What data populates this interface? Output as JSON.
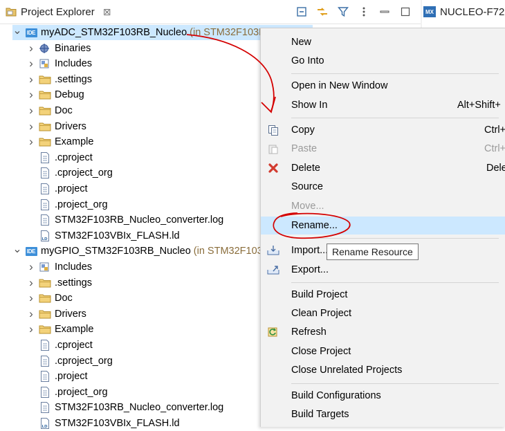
{
  "view": {
    "title": "Project Explorer",
    "close_glyph": "⊠",
    "toolbar": [
      "collapse-all-icon",
      "link-with-editor-icon",
      "filter-icon",
      "view-menu-icon",
      "minimize-icon",
      "maximize-icon"
    ]
  },
  "editor_tab": {
    "badge": "MX",
    "title": "NUCLEO-F72"
  },
  "tree": [
    {
      "label": "myADC_STM32F103RB_Nucleo",
      "decor": "(in STM32F103RB_Nucleo)",
      "icon": "ide",
      "indent": 0,
      "expandable": true,
      "expanded": true,
      "selected": true
    },
    {
      "label": "Binaries",
      "icon": "binaries",
      "indent": 1,
      "expandable": true
    },
    {
      "label": "Includes",
      "icon": "includes",
      "indent": 1,
      "expandable": true
    },
    {
      "label": ".settings",
      "icon": "folder",
      "indent": 1,
      "expandable": true
    },
    {
      "label": "Debug",
      "icon": "folder",
      "indent": 1,
      "expandable": true
    },
    {
      "label": "Doc",
      "icon": "folder",
      "indent": 1,
      "expandable": true
    },
    {
      "label": "Drivers",
      "icon": "folder",
      "indent": 1,
      "expandable": true
    },
    {
      "label": "Example",
      "icon": "folder",
      "indent": 1,
      "expandable": true
    },
    {
      "label": ".cproject",
      "icon": "file",
      "indent": 1
    },
    {
      "label": ".cproject_org",
      "icon": "file",
      "indent": 1
    },
    {
      "label": ".project",
      "icon": "file",
      "indent": 1
    },
    {
      "label": ".project_org",
      "icon": "file",
      "indent": 1
    },
    {
      "label": "STM32F103RB_Nucleo_converter.log",
      "icon": "file",
      "indent": 1
    },
    {
      "label": "STM32F103VBIx_FLASH.ld",
      "icon": "ld",
      "indent": 1
    },
    {
      "label": "myGPIO_STM32F103RB_Nucleo",
      "decor": "(in STM32F103R",
      "icon": "ide",
      "indent": 0,
      "expandable": true,
      "expanded": true
    },
    {
      "label": "Includes",
      "icon": "includes",
      "indent": 1,
      "expandable": true
    },
    {
      "label": ".settings",
      "icon": "folder",
      "indent": 1,
      "expandable": true
    },
    {
      "label": "Doc",
      "icon": "folder",
      "indent": 1,
      "expandable": true
    },
    {
      "label": "Drivers",
      "icon": "folder",
      "indent": 1,
      "expandable": true
    },
    {
      "label": "Example",
      "icon": "folder",
      "indent": 1,
      "expandable": true
    },
    {
      "label": ".cproject",
      "icon": "file",
      "indent": 1
    },
    {
      "label": ".cproject_org",
      "icon": "file",
      "indent": 1
    },
    {
      "label": ".project",
      "icon": "file",
      "indent": 1
    },
    {
      "label": ".project_org",
      "icon": "file",
      "indent": 1
    },
    {
      "label": "STM32F103RB_Nucleo_converter.log",
      "icon": "file",
      "indent": 1
    },
    {
      "label": "STM32F103VBIx_FLASH.ld",
      "icon": "ld",
      "indent": 1
    }
  ],
  "menu": [
    {
      "label": "New"
    },
    {
      "label": "Go Into"
    },
    {
      "sep": true
    },
    {
      "label": "Open in New Window"
    },
    {
      "label": "Show In",
      "shortcut": "Alt+Shift+"
    },
    {
      "sep": true
    },
    {
      "label": "Copy",
      "shortcut": "Ctrl+",
      "icon": "copy-icon"
    },
    {
      "label": "Paste",
      "shortcut": "Ctrl+",
      "icon": "paste-icon",
      "disabled": true
    },
    {
      "label": "Delete",
      "shortcut": "Dele",
      "icon": "delete-icon"
    },
    {
      "label": "Source"
    },
    {
      "label": "Move...",
      "disabled": true
    },
    {
      "label": "Rename...",
      "highlighted": true
    },
    {
      "sep": true
    },
    {
      "label": "Import...",
      "icon": "import-icon"
    },
    {
      "label": "Export...",
      "icon": "export-icon"
    },
    {
      "sep": true
    },
    {
      "label": "Build Project"
    },
    {
      "label": "Clean Project"
    },
    {
      "label": "Refresh",
      "icon": "refresh-icon"
    },
    {
      "label": "Close Project"
    },
    {
      "label": "Close Unrelated Projects"
    },
    {
      "sep": true
    },
    {
      "label": "Build Configurations"
    },
    {
      "label": "Build Targets"
    }
  ],
  "tooltip": "Rename Resource",
  "colors": {
    "selection": "#cce8ff",
    "annotation": "#d40000",
    "menu_bg": "#f2f2f2"
  }
}
